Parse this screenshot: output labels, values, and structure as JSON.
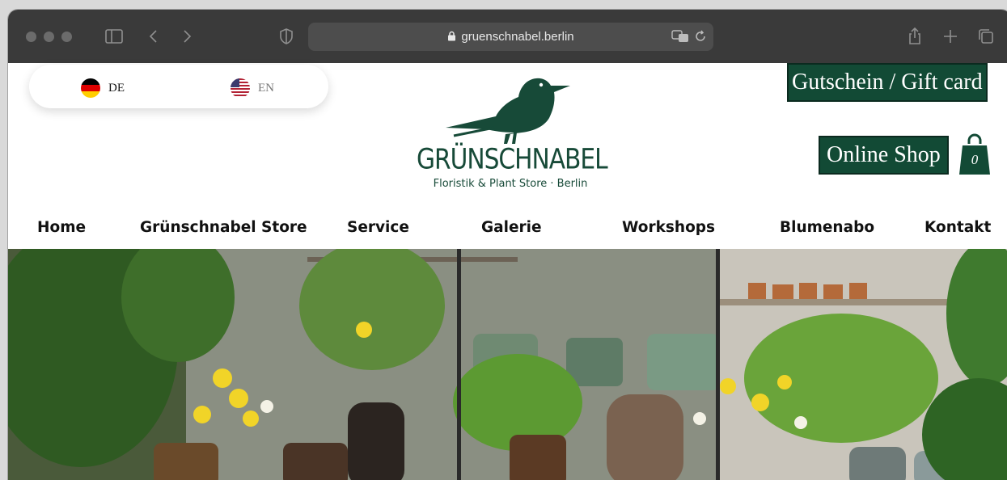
{
  "browser": {
    "url": "gruenschnabel.berlin"
  },
  "languages": [
    {
      "code": "DE",
      "flag": "germany-flag",
      "active": true
    },
    {
      "code": "EN",
      "flag": "usa-flag",
      "active": false
    }
  ],
  "logo": {
    "name": "GRÜNSCHNABEL",
    "tagline": "Floristik & Plant Store · Berlin"
  },
  "header": {
    "gift_label": "Gutschein / Gift card",
    "shop_label": "Online Shop",
    "cart_count": "0"
  },
  "nav": [
    "Home",
    "Grünschnabel Store",
    "Service",
    "Galerie",
    "Workshops",
    "Blumenabo",
    "Kontakt"
  ],
  "colors": {
    "brand_green": "#124a35",
    "chrome_dark": "#3a3a3a"
  }
}
